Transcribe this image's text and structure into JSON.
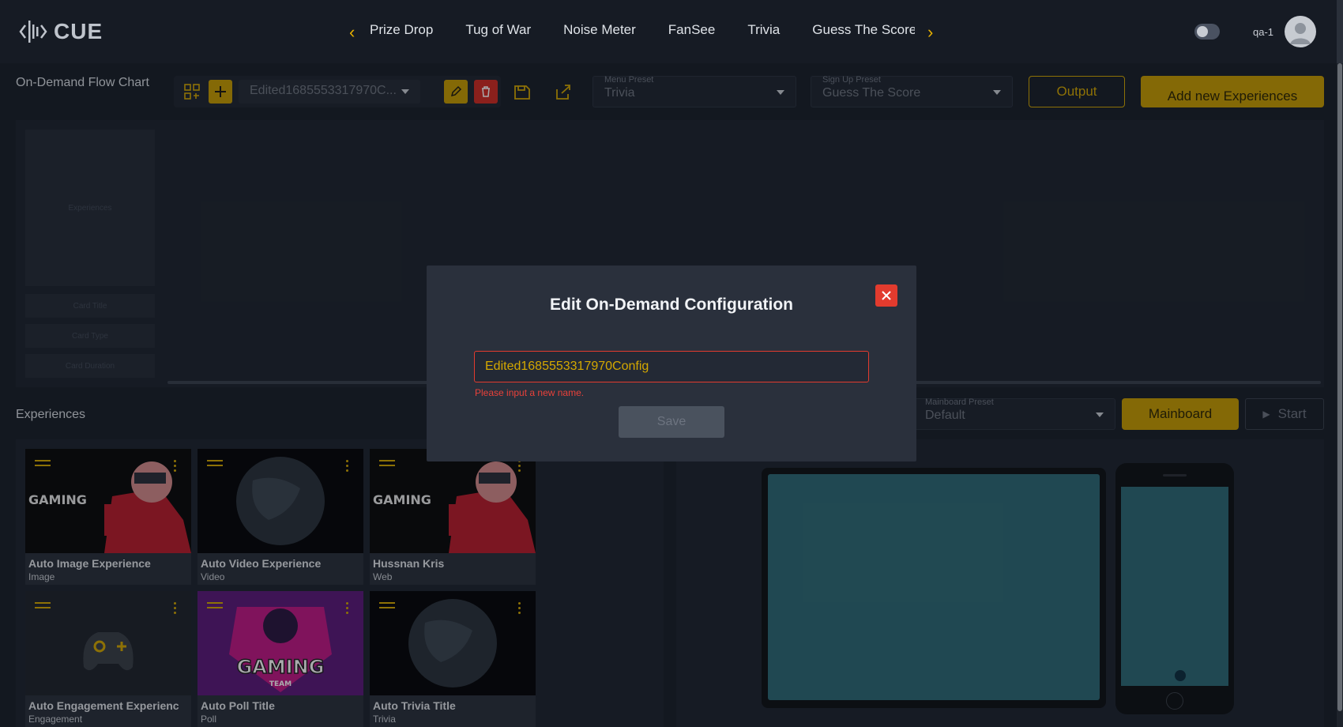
{
  "app": {
    "logo_text": "CUE",
    "user_name": "qa-1"
  },
  "nav": {
    "tabs": [
      "Prize Drop",
      "Tug of War",
      "Noise Meter",
      "FanSee",
      "Trivia",
      "Guess The Score"
    ]
  },
  "flow": {
    "title": "On-Demand Flow Chart",
    "config_select": "Edited1685553317970C...",
    "menu_preset_label": "Menu Preset",
    "menu_preset_value": "Trivia",
    "signup_preset_label": "Sign Up Preset",
    "signup_preset_value": "Guess The Score",
    "output_label": "Output",
    "add_new_label": "Add new Experiences"
  },
  "canvas": {
    "card_label": "Experiences",
    "fields": [
      "Card Title",
      "Card Type",
      "Card Duration"
    ]
  },
  "experiences": {
    "title": "Experiences",
    "items": [
      {
        "title": "Auto Image Experience",
        "type": "Image"
      },
      {
        "title": "Auto Video Experience",
        "type": "Video"
      },
      {
        "title": "Hussnan Kris",
        "type": "Web"
      },
      {
        "title": "Auto Engagement Experienc",
        "type": "Engagement"
      },
      {
        "title": "Auto Poll Title",
        "type": "Poll"
      },
      {
        "title": "Auto Trivia Title",
        "type": "Trivia"
      }
    ]
  },
  "mainboard": {
    "preset_label": "Mainboard Preset",
    "preset_value": "Default",
    "mainboard_label": "Mainboard",
    "start_label": "Start"
  },
  "modal": {
    "title": "Edit On-Demand Configuration",
    "input_value": "Edited1685553317970Config",
    "error": "Please input a new name.",
    "save_label": "Save"
  },
  "thumb_text": {
    "gaming": "GAMING",
    "gaming_team": "GAMING",
    "team": "TEAM"
  },
  "colors": {
    "accent": "#d4a800",
    "danger": "#e23b2e",
    "preview_screen": "#2d6975"
  }
}
